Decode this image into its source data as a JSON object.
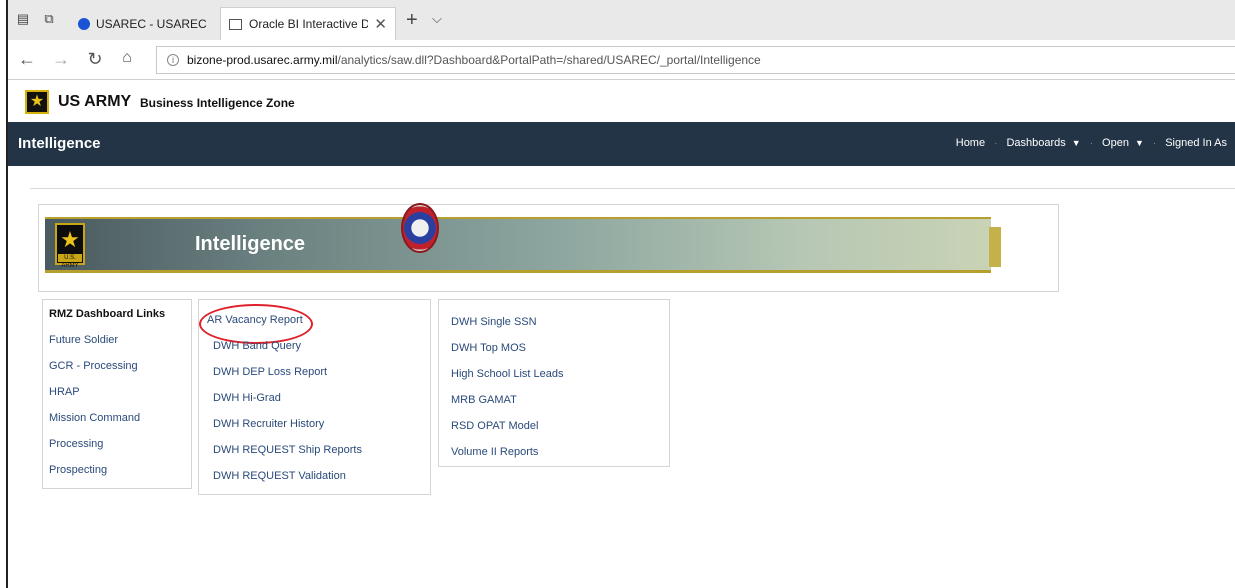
{
  "browser": {
    "tabs": [
      {
        "title": "USAREC - USAREC - IKROm",
        "active": false
      },
      {
        "title": "Oracle BI Interactive Da",
        "active": true
      }
    ],
    "url_host": "bizone-prod.usarec.army.mil",
    "url_path": "/analytics/saw.dll?Dashboard&PortalPath=/shared/USAREC/_portal/Intelligence",
    "icons": {
      "tab_actions": "tab-actions-icon",
      "tabs_aside": "tabs-aside-icon",
      "back": "back-arrow-icon",
      "forward": "forward-arrow-icon",
      "refresh": "refresh-icon",
      "home": "home-icon",
      "info": "info-icon",
      "close_tab": "close-icon",
      "new_tab": "plus-icon",
      "tab_menu": "chevron-down-icon"
    }
  },
  "header": {
    "brand": "US ARMY",
    "product": "Business Intelligence Zone"
  },
  "nav": {
    "title": "Intelligence",
    "links": [
      "Home",
      "Dashboards",
      "Open",
      "Signed In As"
    ]
  },
  "banner": {
    "title": "Intelligence",
    "logo_text": "U.S. ARMY"
  },
  "panels": {
    "rmz": {
      "heading": "RMZ Dashboard Links",
      "links": [
        "Future Soldier",
        "GCR - Processing",
        "HRAP",
        "Mission Command",
        "Processing",
        "Prospecting"
      ]
    },
    "reports_a": {
      "links": [
        "AR Vacancy Report",
        "DWH Band Query",
        "DWH DEP Loss Report",
        "DWH Hi-Grad",
        "DWH Recruiter History",
        "DWH REQUEST Ship Reports",
        "DWH REQUEST Validation"
      ]
    },
    "reports_b": {
      "links": [
        "DWH Single SSN",
        "DWH Top MOS",
        "High School List Leads",
        "MRB GAMAT",
        "RSD OPAT Model",
        "Volume II Reports"
      ]
    }
  },
  "colors": {
    "nav_bg": "#233447",
    "highlight_ring": "#e0202a",
    "link": "#2a4a7a"
  }
}
